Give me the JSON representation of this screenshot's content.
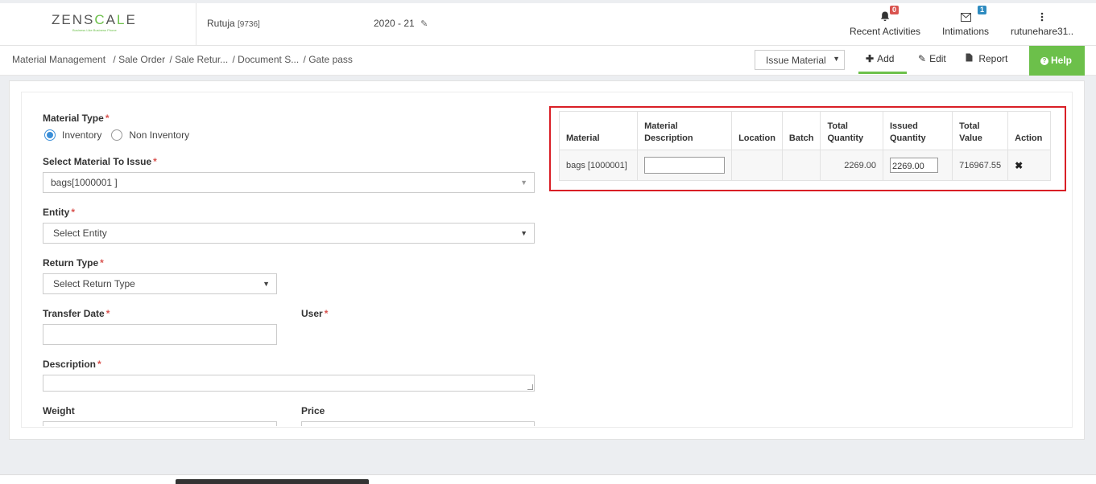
{
  "header": {
    "logo": {
      "pre": "ZENS",
      "accent": "C",
      "mid": "A",
      "accent2": "L",
      "post": "E",
      "tagline": "Business Like Business Phone"
    },
    "company_name": "Rutuja",
    "company_code": "[9736]",
    "fiscal_year": "2020 - 21",
    "recent_activities": {
      "label": "Recent Activities",
      "count": "0"
    },
    "intimations": {
      "label": "Intimations",
      "count": "1"
    },
    "user": {
      "label": "rutunehare31.."
    }
  },
  "breadcrumb": {
    "items": [
      "Material Management",
      "/ Sale Order",
      "/ Sale Retur...",
      "/ Document S...",
      "/ Gate pass"
    ]
  },
  "toolbar": {
    "mode_select": "Issue Material",
    "add": "Add",
    "edit": "Edit",
    "report": "Report",
    "help": "Help"
  },
  "form": {
    "material_type_label": "Material Type",
    "material_type_options": [
      "Inventory",
      "Non Inventory"
    ],
    "material_type_selected": "Inventory",
    "select_material_label": "Select Material To Issue",
    "select_material_value": "bags[1000001 ]",
    "entity_label": "Entity",
    "entity_placeholder": "Select Entity",
    "return_type_label": "Return Type",
    "return_type_placeholder": "Select Return Type",
    "transfer_date_label": "Transfer Date",
    "user_label": "User",
    "description_label": "Description",
    "weight_label": "Weight",
    "price_label": "Price",
    "required_mark": "*"
  },
  "table": {
    "columns": [
      "Material",
      "Material Description",
      "Location",
      "Batch",
      "Total Quantity",
      "Issued Quantity",
      "Total Value",
      "Action"
    ],
    "rows": [
      {
        "material": "bags [1000001]",
        "description": "",
        "location": "",
        "batch": "",
        "total_quantity": "2269.00",
        "issued_quantity": "2269.00",
        "total_value": "716967.55",
        "action": "✖"
      }
    ]
  },
  "colors": {
    "accent_green": "#6cc04a",
    "required_red": "#d9534f",
    "highlight_frame": "#d91f26",
    "radio_blue": "#3a8ed8"
  }
}
